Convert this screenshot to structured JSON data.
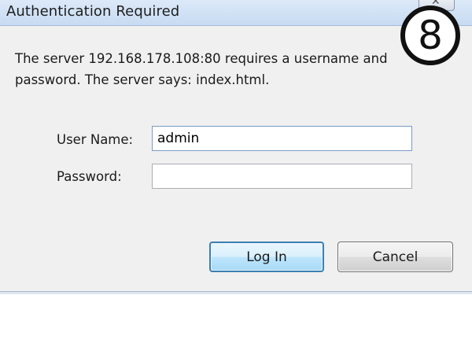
{
  "dialog": {
    "title": "Authentication Required",
    "message_line1": "The server 192.168.178.108:80 requires a username and",
    "message_line2": "password. The server says: index.html."
  },
  "badge": {
    "step_number": "8"
  },
  "form": {
    "username_label": "User Name:",
    "username_value": "admin",
    "password_label": "Password:",
    "password_value": ""
  },
  "buttons": {
    "login_label": "Log In",
    "cancel_label": "Cancel"
  },
  "colors": {
    "titlebar": "#c7dbf2",
    "dialog_background": "#f0f0f0",
    "default_button_border": "#3c7fb1"
  },
  "icons": {
    "window_close": "close-icon"
  }
}
